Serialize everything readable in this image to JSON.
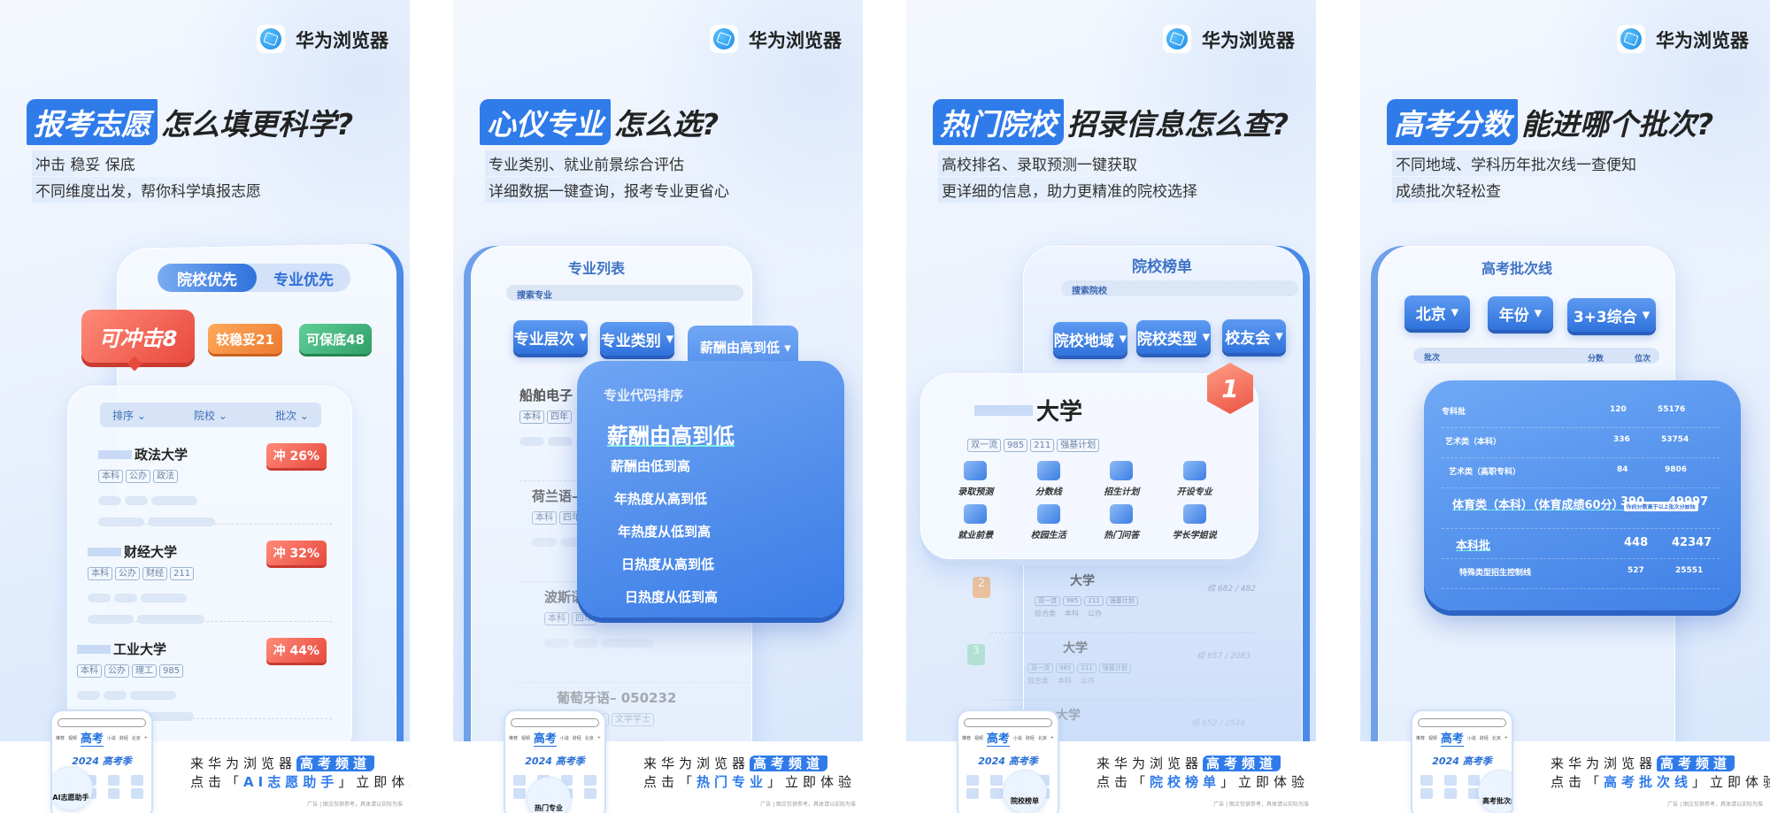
{
  "brand": "华为浏览器",
  "colors": {
    "accent": "#2f7bea",
    "red": "#ef5a4c",
    "orange": "#f08a3a",
    "green": "#3eb37a"
  },
  "footer": {
    "line1": "来华为浏览器",
    "line1_highlight": "高考频道",
    "line2_prefix": "点击「",
    "line2_suffix": "」立即体验",
    "disclaimer": "广告 | 图文仅供参考，具体请以实际为准",
    "mini_tabs": [
      "推荐",
      "视频",
      "高考",
      "小说",
      "财经",
      "北京",
      "+"
    ],
    "mini_banner": "2024 高考季"
  },
  "posters": [
    {
      "headline_hl": "报考志愿",
      "headline_rest": "怎么填更科学?",
      "sub1": "冲击 稳妥 保底",
      "sub2": "不同维度出发，帮你科学填报志愿",
      "cta": "AI志愿助手",
      "mini_focus": "AI志愿助手",
      "toggle": [
        "院校优先",
        "专业优先"
      ],
      "bubbles": [
        "可冲击8",
        "较稳妥21",
        "可保底48"
      ],
      "filters": [
        "排序",
        "院校",
        "批次"
      ],
      "schools": [
        {
          "name": "政法大学",
          "tags": [
            "本科",
            "公办",
            "政法"
          ],
          "chance": "冲 26%"
        },
        {
          "name": "财经大学",
          "tags": [
            "本科",
            "公办",
            "财经",
            "211"
          ],
          "chance": "冲 32%"
        },
        {
          "name": "工业大学",
          "tags": [
            "本科",
            "公办",
            "理工",
            "985"
          ],
          "chance": "冲 44%"
        }
      ]
    },
    {
      "headline_hl": "心仪专业",
      "headline_rest": "怎么选?",
      "sub1": "专业类别、就业前景综合评估",
      "sub2": "详细数据一键查询，报考专业更省心",
      "cta": "热门专业",
      "mini_focus": "热门专业",
      "title": "专业列表",
      "search_placeholder": "搜索专业",
      "filters": [
        "专业层次",
        "专业类别",
        "薪酬由高到低"
      ],
      "menu": [
        "专业代码排序",
        "薪酬由高到低",
        "薪酬由低到高",
        "年热度从高到低",
        "年热度从低到高",
        "日热度从高到低",
        "日热度从低到高"
      ],
      "menu_selected": 1,
      "majors": [
        {
          "name": "船舶电子",
          "tags": [
            "本科",
            "四年"
          ]
        },
        {
          "name": "荷兰语—",
          "tags": [
            "本科",
            "四年"
          ]
        },
        {
          "name": "波斯语—",
          "tags": [
            "本科",
            "四年"
          ]
        },
        {
          "name": "葡萄牙语– 050232",
          "tags": [
            "本科",
            "四年",
            "文学学士"
          ]
        }
      ]
    },
    {
      "headline_hl": "热门院校",
      "headline_rest": "招录信息怎么查?",
      "sub1": "高校排名、录取预测一键获取",
      "sub2": "更详细的信息，助力更精准的院校选择",
      "cta": "院校榜单",
      "mini_focus": "院校榜单",
      "title": "院校榜单",
      "search_placeholder": "搜索院校",
      "filters": [
        "院校地域",
        "院校类型",
        "校友会"
      ],
      "top": {
        "rank": "1",
        "name": "大学",
        "tags": [
          "双一流",
          "985",
          "211",
          "强基计划"
        ]
      },
      "features": [
        "录取预测",
        "分数线",
        "招生计划",
        "开设专业",
        "就业前景",
        "校园生活",
        "热门问答",
        "学长学姐说"
      ],
      "rows": [
        {
          "rank": "2",
          "name": "大学",
          "tags": [
            "双一流",
            "985",
            "211",
            "强基计划"
          ],
          "meta": [
            "综合类",
            "本科",
            "公办"
          ],
          "score": "综 682 / 482"
        },
        {
          "rank": "3",
          "name": "大学",
          "tags": [
            "双一流",
            "985",
            "211",
            "强基计划"
          ],
          "meta": [
            "综合类",
            "本科",
            "公办"
          ],
          "score": "综 657 / 2083"
        },
        {
          "rank": "",
          "name": "大学",
          "tags": [
            "强基计划"
          ],
          "meta": [
            "本科",
            "公办"
          ],
          "score": "综 652 / 2544"
        }
      ]
    },
    {
      "headline_hl": "高考分数",
      "headline_rest": "能进哪个批次?",
      "sub1": "不同地域、学科历年批次线一查便知",
      "sub2": "成绩批次轻松查",
      "cta": "高考批次线",
      "mini_focus": "高考批次线",
      "title": "高考批次线",
      "filters": [
        "北京",
        "年份",
        "3+3综合"
      ],
      "columns": [
        "批次",
        "分数",
        "位次"
      ],
      "rows": [
        {
          "name": "专科批",
          "score": "120",
          "rank": "55176"
        },
        {
          "name": "艺术类（本科）",
          "score": "336",
          "rank": "53754"
        },
        {
          "name": "艺术类（高职专科）",
          "score": "84",
          "rank": "9806"
        },
        {
          "name": "体育类（本科）（体育成绩60分）",
          "score": "390",
          "rank": "49997",
          "note": "你的分数高于以上批次分数线",
          "highlight": true
        },
        {
          "name": "本科批",
          "score": "448",
          "rank": "42347",
          "highlight": true
        },
        {
          "name": "特殊类型招生控制线",
          "score": "527",
          "rank": "25551"
        }
      ]
    }
  ]
}
